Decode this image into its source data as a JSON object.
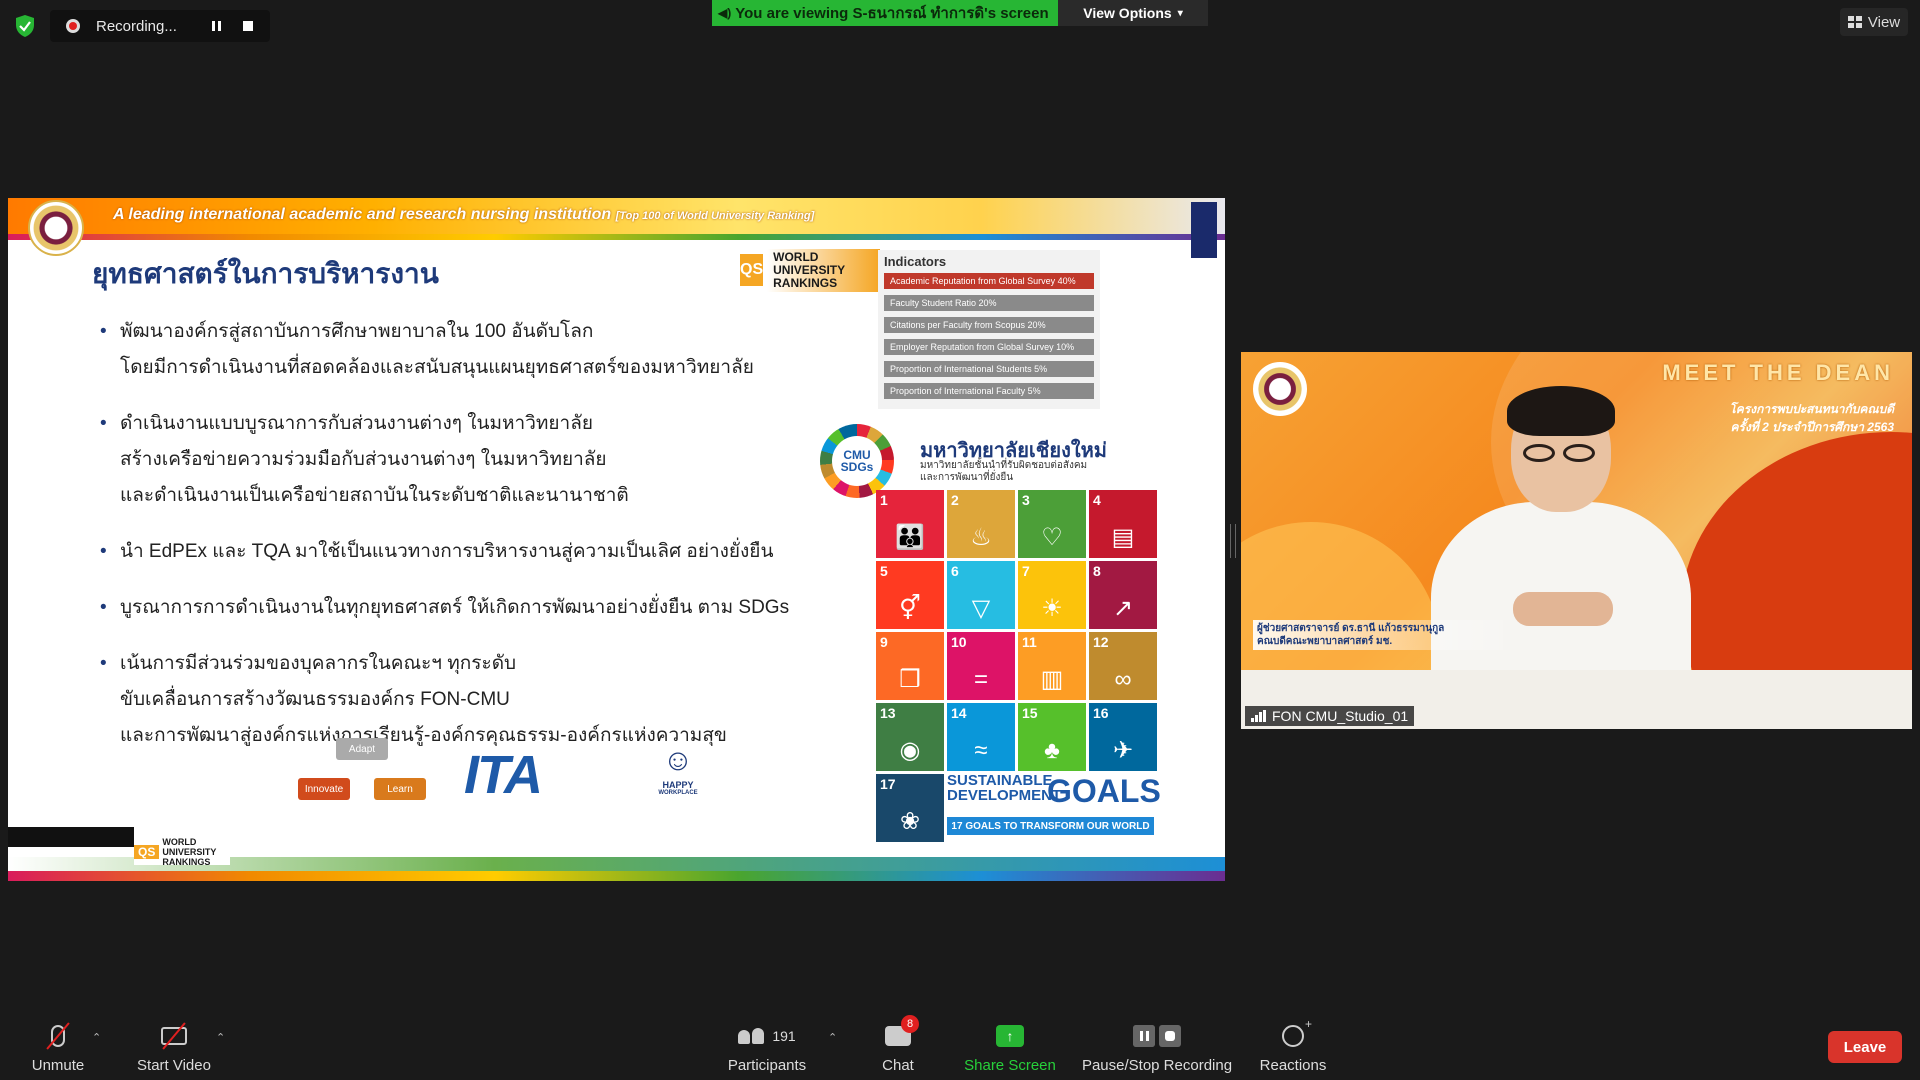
{
  "top_bar": {
    "recording_label": "Recording...",
    "viewing_banner": "You are viewing S-ธนากรณ์ ทำการดิ's screen",
    "view_options_label": "View Options",
    "view_label": "View"
  },
  "slide": {
    "tagline": "A leading international academic and research nursing institution",
    "tagline_note": "[Top 100 of World University Ranking]",
    "title": "ยุทธศาสตร์ในการบริหารงาน",
    "bullets": [
      [
        "พัฒนาองค์กรสู่สถาบันการศึกษาพยาบาลใน 100 อันดับโลก",
        "โดยมีการดำเนินงานที่สอดคล้องและสนับสนุนแผนยุทธศาสตร์ของมหาวิทยาลัย"
      ],
      [
        "ดำเนินงานแบบบูรณาการกับส่วนงานต่างๆ ในมหาวิทยาลัย",
        "สร้างเครือข่ายความร่วมมือกับส่วนงานต่างๆ ในมหาวิทยาลัย",
        "และดำเนินงานเป็นเครือข่ายสถาบันในระดับชาติและนานาชาติ"
      ],
      [
        "นำ EdPEx และ TQA มาใช้เป็นแนวทางการบริหารงานสู่ความเป็นเลิศ อย่างยั่งยืน"
      ],
      [
        "บูรณาการการดำเนินงานในทุกยุทธศาสตร์ ให้เกิดการพัฒนาอย่างยั่งยืน ตาม SDGs"
      ],
      [
        "เน้นการมีส่วนร่วมของบุคลากรในคณะฯ ทุกระดับ",
        "ขับเคลื่อนการสร้างวัฒนธรรมองค์กร FON-CMU",
        "และการพัฒนาสู่องค์กรแห่งการเรียนรู้-องค์กรคุณธรรม-องค์กรแห่งความสุข"
      ]
    ],
    "qs_mark": "QS",
    "qs_text": "WORLD UNIVERSITY RANKINGS",
    "indicators_title": "Indicators",
    "indicators": [
      "Academic Reputation from Global Survey 40%",
      "Faculty Student Ratio 20%",
      "Citations per Faculty from Scopus 20%",
      "Employer Reputation from Global Survey 10%",
      "Proportion of International Students 5%",
      "Proportion of International Faculty 5%"
    ],
    "cmu_sdgs_label": "CMU SDGs",
    "university_name": "มหาวิทยาลัยเชียงใหม่",
    "university_sub_1": "มหาวิทยาลัยชั้นนำที่รับผิดชอบต่อสังคม",
    "university_sub_2": "และการพัฒนาที่ยั่งยืน",
    "sdgs": [
      {
        "n": "1",
        "color": "#e5243b",
        "icon": "people-icon"
      },
      {
        "n": "2",
        "color": "#dda63a",
        "icon": "bowl-icon"
      },
      {
        "n": "3",
        "color": "#4c9f38",
        "icon": "heartbeat-icon"
      },
      {
        "n": "4",
        "color": "#c5192d",
        "icon": "book-icon"
      },
      {
        "n": "5",
        "color": "#ff3a21",
        "icon": "gender-icon"
      },
      {
        "n": "6",
        "color": "#26bde2",
        "icon": "water-icon"
      },
      {
        "n": "7",
        "color": "#fcc30b",
        "icon": "sun-icon"
      },
      {
        "n": "8",
        "color": "#a21942",
        "icon": "growth-chart-icon"
      },
      {
        "n": "9",
        "color": "#fd6925",
        "icon": "cubes-icon"
      },
      {
        "n": "10",
        "color": "#dd1367",
        "icon": "equal-icon"
      },
      {
        "n": "11",
        "color": "#fd9d24",
        "icon": "buildings-icon"
      },
      {
        "n": "12",
        "color": "#bf8b2e",
        "icon": "infinity-icon"
      },
      {
        "n": "13",
        "color": "#3f7e44",
        "icon": "eye-globe-icon"
      },
      {
        "n": "14",
        "color": "#0a97d9",
        "icon": "fish-icon"
      },
      {
        "n": "15",
        "color": "#56c02b",
        "icon": "tree-icon"
      },
      {
        "n": "16",
        "color": "#00689d",
        "icon": "dove-icon"
      },
      {
        "n": "17",
        "color": "#19486a",
        "icon": "flower-icon"
      }
    ],
    "sdg_glyphs": [
      "👪",
      "♨",
      "♡",
      "▤",
      "⚥",
      "▽",
      "☀",
      "↗",
      "❒",
      "=",
      "▥",
      "∞",
      "◉",
      "≈",
      "♣",
      "✈",
      "❀"
    ],
    "goals_small": "SUSTAINABLE DEVELOPMENT",
    "goals_big": "GOALS",
    "goals_sub": "17 GOALS TO TRANSFORM OUR WORLD",
    "cycle": {
      "adapt": "Adapt",
      "innovate": "Innovate",
      "learn": "Learn"
    },
    "ita_text": "ITA",
    "happy_text": "HAPPY",
    "happy_sub": "WORKPLACE",
    "footer_qs_mark": "QS",
    "footer_qs_text": "WORLD UNIVERSITY RANKINGS"
  },
  "camera": {
    "meet_title": "MEET THE DEAN",
    "meet_sub_1": "โครงการพบปะสนทนากับคณบดี",
    "meet_sub_2": "ครั้งที่ 2 ประจำปีการศึกษา 2563",
    "name_line_1": "ผู้ช่วยศาสตราจารย์ ดร.ธานี แก้วธรรมานุกูล",
    "name_line_2": "คณบดีคณะพยาบาลศาสตร์ มช.",
    "participant_name": "FON CMU_Studio_01"
  },
  "toolbar": {
    "unmute": "Unmute",
    "start_video": "Start Video",
    "participants": "Participants",
    "participants_count": "191",
    "chat": "Chat",
    "chat_badge": "8",
    "share_screen": "Share Screen",
    "pause_stop": "Pause/Stop Recording",
    "reactions": "Reactions",
    "leave": "Leave"
  },
  "colors": {
    "share_green": "#27b634",
    "leave_red": "#d9342b",
    "background": "#1a1a1a"
  }
}
